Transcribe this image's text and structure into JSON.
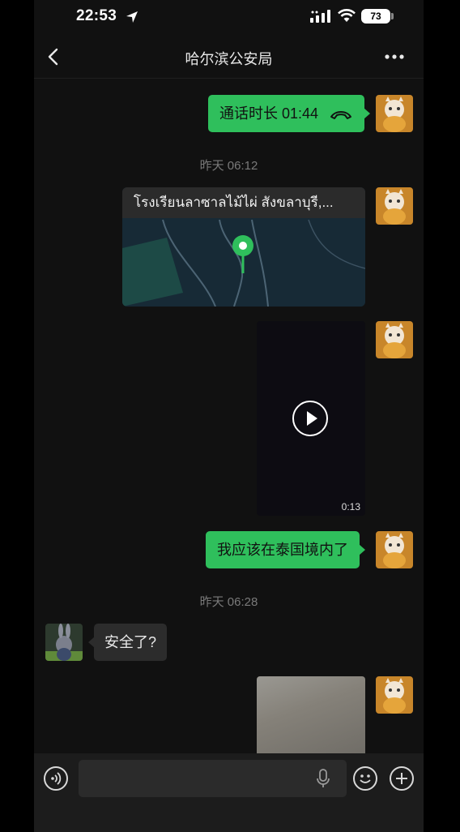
{
  "status_bar": {
    "time": "22:53",
    "battery": "73"
  },
  "header": {
    "title": "哈尔滨公安局"
  },
  "messages": {
    "call": {
      "label": "通话时长 01:44"
    },
    "time1": "昨天 06:12",
    "location": {
      "name": "โรงเรียนลาซาลไม้ไผ่ สังขลาบุรี,..."
    },
    "video": {
      "duration": "0:13"
    },
    "text1": "我应该在泰国境内了",
    "time2": "昨天 06:28",
    "reply": "安全了?"
  },
  "input": {
    "placeholder": ""
  },
  "colors": {
    "accent": "#2fbf5c",
    "background": "#111111",
    "bubble_dark": "#2c2c2c"
  }
}
